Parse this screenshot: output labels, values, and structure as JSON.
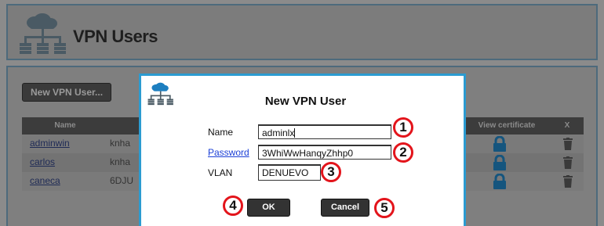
{
  "page": {
    "title": "VPN Users",
    "new_user_button": "New VPN User...",
    "table": {
      "headers": {
        "name": "Name",
        "view_certificate": "View certificate",
        "delete": "X"
      },
      "rows": [
        {
          "name": "adminwin",
          "password_partial": "knha"
        },
        {
          "name": "carlos",
          "password_partial": "knha"
        },
        {
          "name": "caneca",
          "password_partial": "6DJU"
        }
      ]
    }
  },
  "dialog": {
    "title": "New VPN User",
    "name_label": "Name",
    "name_value": "adminlx",
    "password_label": "Password",
    "password_value": "3WhiWwHanqyZhhp0",
    "vlan_label": "VLAN",
    "vlan_value": "DENUEVO",
    "ok_label": "OK",
    "cancel_label": "Cancel"
  },
  "annotations": [
    "1",
    "2",
    "3",
    "4",
    "5"
  ],
  "colors": {
    "dialog_border": "#2b9bd1",
    "badge_ring": "#e3141b",
    "link": "#1b3fd6",
    "icon_blue": "#1d7fc0"
  },
  "icons": [
    "cloud-network-icon",
    "lock-icon",
    "trash-icon"
  ]
}
